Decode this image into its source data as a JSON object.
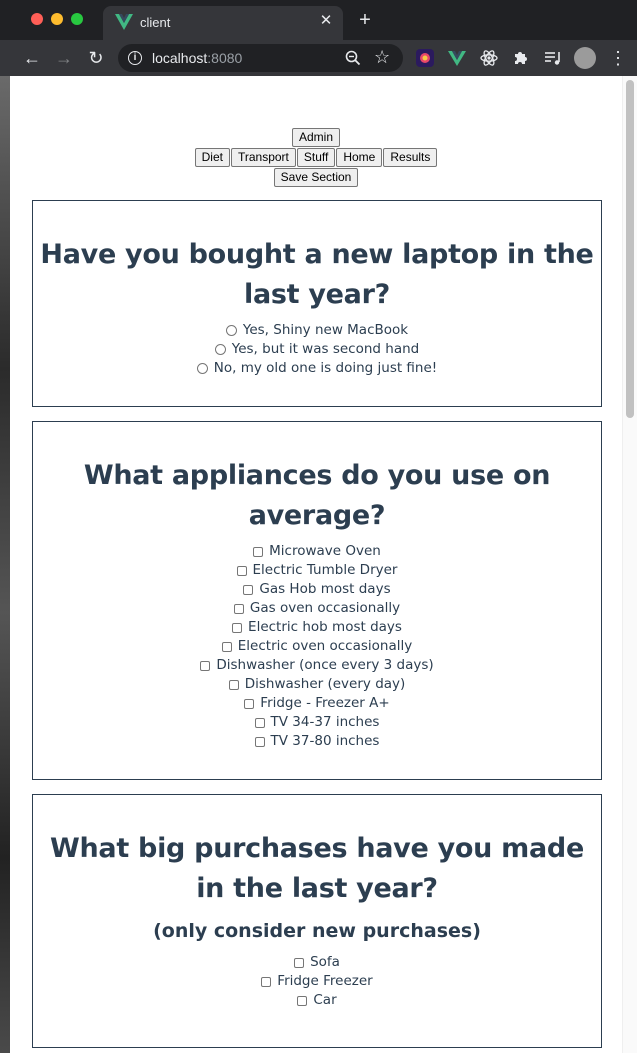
{
  "browser": {
    "tab_title": "client",
    "url_host": "localhost",
    "url_port": ":8080"
  },
  "nav": {
    "admin": "Admin",
    "tabs": [
      "Diet",
      "Transport",
      "Stuff",
      "Home",
      "Results"
    ],
    "save_section": "Save Section"
  },
  "questions": [
    {
      "title": "Have you bought a new laptop in the last year?",
      "type": "radio",
      "options": [
        "Yes, Shiny new MacBook",
        "Yes, but it was second hand",
        "No, my old one is doing just fine!"
      ]
    },
    {
      "title": "What appliances do you use on average?",
      "type": "checkbox",
      "options": [
        "Microwave Oven",
        "Electric Tumble Dryer",
        "Gas Hob most days",
        "Gas oven occasionally",
        "Electric hob most days",
        "Electric oven occasionally",
        "Dishwasher (once every 3 days)",
        "Dishwasher (every day)",
        "Fridge - Freezer A+",
        "TV 34-37 inches",
        "TV 37-80 inches"
      ]
    },
    {
      "title": "What big purchases have you made in the last year?",
      "subtitle": "(only consider new purchases)",
      "type": "checkbox",
      "options": [
        "Sofa",
        "Fridge Freezer",
        "Car"
      ]
    }
  ],
  "colors": {
    "heading": "#2c3e50",
    "chrome_dark": "#202124",
    "chrome_toolbar": "#35363a",
    "vue_green": "#41b883"
  }
}
